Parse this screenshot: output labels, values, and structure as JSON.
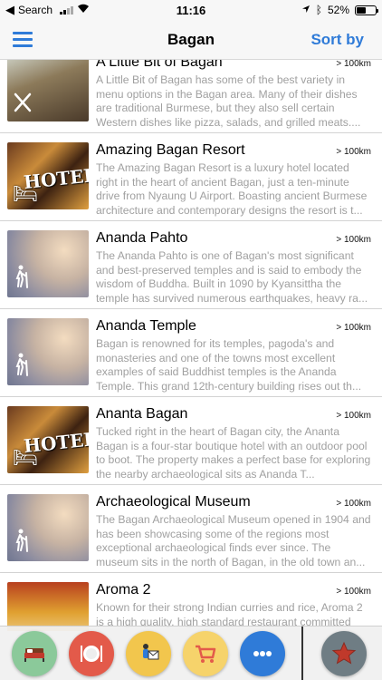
{
  "status": {
    "back_label": "Search",
    "time": "11:16",
    "battery": "52%",
    "battery_level": 0.52
  },
  "nav": {
    "title": "Bagan",
    "sort_label": "Sort by"
  },
  "items": [
    {
      "title": "A Little Bit of Bagan",
      "distance": "> 100km",
      "description": "A Little Bit of Bagan has some of the best variety in menu options in the Bagan area. Many of their dishes are traditional Burmese, but they also sell certain Western dishes like pizza, salads, and grilled meats....",
      "thumb": "restaurant"
    },
    {
      "title": "Amazing Bagan Resort",
      "distance": "> 100km",
      "description": "The Amazing Bagan Resort is a luxury hotel located right in the heart of ancient Bagan, just a ten-minute drive from Nyaung U Airport. Boasting ancient Burmese architecture and contemporary designs the resort is t...",
      "thumb": "hotel",
      "thumb_text": "HOTEL"
    },
    {
      "title": "Ananda Pahto",
      "distance": "> 100km",
      "description": "The Ananda Pahto is one of Bagan's most significant and best-preserved temples and is said to embody the wisdom of Buddha. Built in 1090 by Kyansittha the temple has survived numerous earthquakes, heavy ra...",
      "thumb": "hike"
    },
    {
      "title": "Ananda Temple",
      "distance": "> 100km",
      "description": "Bagan is renowned for its temples, pagoda's and monasteries and one of the towns most excellent examples of said Buddhist temples is the Ananda Temple. This grand 12th-century building rises out th...",
      "thumb": "hike"
    },
    {
      "title": "Ananta Bagan",
      "distance": "> 100km",
      "description": "Tucked right in the heart of Bagan city, the Ananta Bagan is a four-star boutique hotel with an outdoor pool to boot. The property makes a perfect base for exploring the nearby archaeological sits as Ananda T...",
      "thumb": "hotel",
      "thumb_text": "HOTEL"
    },
    {
      "title": "Archaeological Museum",
      "distance": "> 100km",
      "description": "The Bagan Archaeological Museum opened in 1904 and has been showcasing some of the regions most exceptional archaeological finds ever since. The museum sits in the north of Bagan, in the old town an...",
      "thumb": "hike"
    },
    {
      "title": "Aroma 2",
      "distance": "> 100km",
      "description": "Known for their strong Indian curries and rice, Aroma 2 is a high quality, high standard restaurant committed to...",
      "thumb": "food"
    }
  ],
  "tabs": [
    {
      "name": "hotels",
      "icon": "bed-icon",
      "color": "#8bc99a"
    },
    {
      "name": "restaurants",
      "icon": "plate-icon",
      "color": "#e35a4a"
    },
    {
      "name": "guide",
      "icon": "tourist-icon",
      "color": "#f2c64d"
    },
    {
      "name": "shopping",
      "icon": "cart-icon",
      "color": "#f6d36b"
    },
    {
      "name": "more",
      "icon": "more-icon",
      "color": "#2f7bd8"
    },
    {
      "name": "favorites",
      "icon": "star-icon",
      "color": "#6f7d84"
    }
  ]
}
